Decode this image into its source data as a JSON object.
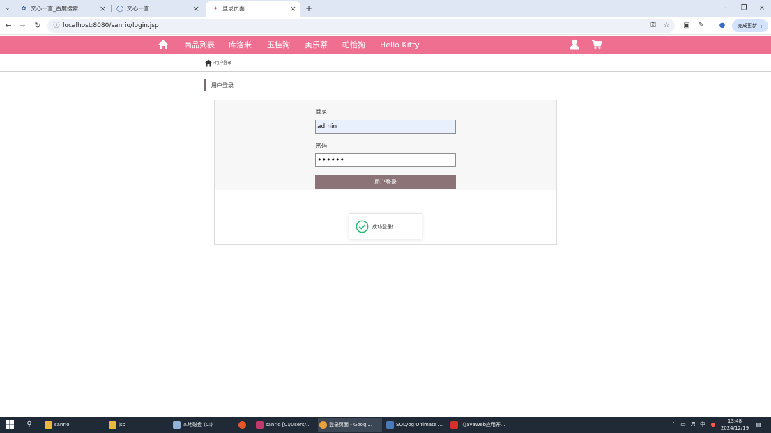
{
  "browser": {
    "tabs": [
      {
        "title": "文心一言_百度搜索",
        "favicon": "baidu-paw-icon",
        "active": false
      },
      {
        "title": "文心一言",
        "favicon": "wenxin-icon",
        "active": false
      },
      {
        "title": "登录页面",
        "favicon": "page-icon",
        "active": true
      }
    ],
    "url": "localhost:8080/sanrio/login.jsp",
    "update_label": "完成更新"
  },
  "site": {
    "brand_color": "#ef6f90",
    "nav_items": [
      "商品列表",
      "库洛米",
      "玉桂狗",
      "美乐蒂",
      "帕恰狗",
      "Hello Kitty"
    ],
    "breadcrumb": "›用户登录",
    "section_title": "用户登录"
  },
  "login_form": {
    "username_label": "登录",
    "username_value": "admin",
    "password_label": "密码",
    "password_value": "••••••",
    "submit_label": "用户登录"
  },
  "toast": {
    "message": "成功登录！",
    "status_color": "#2bb673"
  },
  "taskbar": {
    "items": [
      {
        "label": "sanrio",
        "icon": "folder-icon",
        "active": false
      },
      {
        "label": "jsp",
        "icon": "folder-icon",
        "active": false
      },
      {
        "label": "本地磁盘 (C:)",
        "icon": "drive-icon",
        "active": false
      },
      {
        "label": "",
        "icon": "firefox-icon",
        "active": false
      },
      {
        "label": "sanrio [C:/Users/...",
        "icon": "intellij-icon",
        "active": false
      },
      {
        "label": "登录页面 - Googl...",
        "icon": "chrome-icon",
        "active": true
      },
      {
        "label": "SQLyog Ultimate ...",
        "icon": "sqlyog-icon",
        "active": false
      },
      {
        "label": "《JavaWeb应用开...",
        "icon": "wps-icon",
        "active": false
      }
    ],
    "ime_label": "中",
    "time": "13:48",
    "date": "2024/12/19"
  }
}
